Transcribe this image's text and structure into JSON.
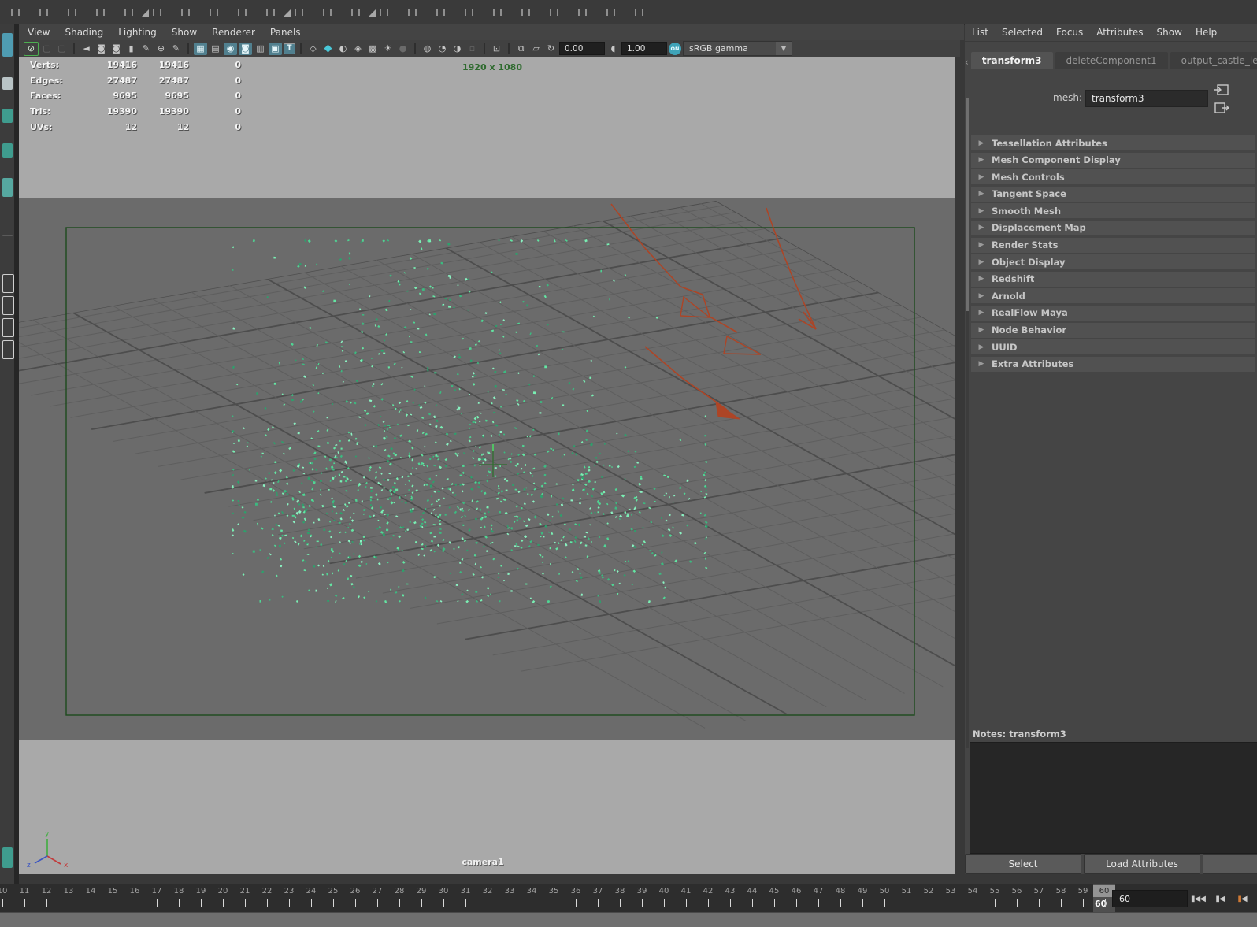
{
  "colors": {
    "accent_teal": "#49c8d8",
    "gate_green": "#1d4a1d",
    "resolution_green": "#2f6b2f",
    "arrow_red": "#ad4526",
    "particle_green": "#63e6a3",
    "selected_green": "#4caf50"
  },
  "viewport": {
    "menus": [
      "View",
      "Shading",
      "Lighting",
      "Show",
      "Renderer",
      "Panels"
    ],
    "toolbar": {
      "icons": [
        {
          "name": "no-live-surface-icon",
          "glyph": "⊘",
          "state": "green"
        },
        {
          "name": "lasso-select-icon",
          "glyph": "▢",
          "state": "dim"
        },
        {
          "name": "paint-select-icon",
          "glyph": "▢",
          "state": "dim"
        },
        {
          "name": "sep"
        },
        {
          "name": "select-camera-icon",
          "glyph": "◄",
          "state": ""
        },
        {
          "name": "lock-camera-icon",
          "glyph": "◙",
          "state": ""
        },
        {
          "name": "camera-attributes-icon",
          "glyph": "◙",
          "state": ""
        },
        {
          "name": "bookmark-icon",
          "glyph": "▮",
          "state": ""
        },
        {
          "name": "image-plane-icon",
          "glyph": "✎",
          "state": ""
        },
        {
          "name": "pan-zoom-icon",
          "glyph": "⊕",
          "state": ""
        },
        {
          "name": "grease-pencil-icon",
          "glyph": "✎",
          "state": ""
        },
        {
          "name": "sep"
        },
        {
          "name": "grid-toggle-icon",
          "glyph": "▦",
          "state": "on"
        },
        {
          "name": "film-gate-icon",
          "glyph": "▤",
          "state": ""
        },
        {
          "name": "resolution-gate-icon",
          "glyph": "◉",
          "state": "on"
        },
        {
          "name": "gate-mask-icon",
          "glyph": "◙",
          "state": "on"
        },
        {
          "name": "field-chart-icon",
          "glyph": "▥",
          "state": ""
        },
        {
          "name": "safe-action-icon",
          "glyph": "▣",
          "state": "on"
        },
        {
          "name": "safe-title-icon",
          "glyph": "T",
          "state": "on tbox"
        },
        {
          "name": "sep"
        },
        {
          "name": "wireframe-mode-icon",
          "glyph": "◇",
          "state": ""
        },
        {
          "name": "shaded-mode-icon",
          "glyph": "◆",
          "state": "teal"
        },
        {
          "name": "textured-mode-icon",
          "glyph": "◐",
          "state": ""
        },
        {
          "name": "materials-icon",
          "glyph": "◈",
          "state": ""
        },
        {
          "name": "wireframe-on-shaded-icon",
          "glyph": "▩",
          "state": ""
        },
        {
          "name": "lights-icon",
          "glyph": "☀",
          "state": ""
        },
        {
          "name": "shadows-icon",
          "glyph": "●",
          "state": "dim"
        },
        {
          "name": "sep"
        },
        {
          "name": "ao-icon",
          "glyph": "◍",
          "state": ""
        },
        {
          "name": "antialias-icon",
          "glyph": "◔",
          "state": ""
        },
        {
          "name": "motion-blur-icon",
          "glyph": "◑",
          "state": ""
        },
        {
          "name": "dof-icon",
          "glyph": "▫",
          "state": "dim"
        },
        {
          "name": "sep"
        },
        {
          "name": "isolate-select-icon",
          "glyph": "⊡",
          "state": ""
        },
        {
          "name": "sep"
        },
        {
          "name": "xray-icon",
          "glyph": "⧉",
          "state": ""
        },
        {
          "name": "xray-active-icon",
          "glyph": "▱",
          "state": ""
        },
        {
          "name": "exposure-icon",
          "glyph": "↻",
          "state": ""
        }
      ],
      "exposure": "0.00",
      "gamma_icon": "◖",
      "gamma": "1.00",
      "on_label": "ON",
      "colorspace": "sRGB gamma",
      "dropdown_arrow": "▼"
    },
    "hud": {
      "rows": [
        {
          "label": "Verts:",
          "a": "19416",
          "b": "19416",
          "c": "0"
        },
        {
          "label": "Edges:",
          "a": "27487",
          "b": "27487",
          "c": "0"
        },
        {
          "label": "Faces:",
          "a": "9695",
          "b": "9695",
          "c": "0"
        },
        {
          "label": "Tris:",
          "a": "19390",
          "b": "19390",
          "c": "0"
        },
        {
          "label": "UVs:",
          "a": "12",
          "b": "12",
          "c": "0"
        }
      ]
    },
    "resolution_label": "1920 x 1080",
    "camera_label": "camera1",
    "axis_labels": {
      "x": "x",
      "y": "y",
      "z": "z"
    }
  },
  "attribute_editor": {
    "menus": [
      "List",
      "Selected",
      "Focus",
      "Attributes",
      "Show",
      "Help"
    ],
    "tabs": [
      {
        "label": "transform3",
        "active": true
      },
      {
        "label": "deleteComponent1",
        "active": false
      },
      {
        "label": "output_castle_leaves_Al",
        "active": false
      }
    ],
    "tab_scroll_left": "‹",
    "mesh_label": "mesh:",
    "mesh_value": "transform3",
    "sections": [
      "Tessellation Attributes",
      "Mesh Component Display",
      "Mesh Controls",
      "Tangent Space",
      "Smooth Mesh",
      "Displacement Map",
      "Render Stats",
      "Object Display",
      "Redshift",
      "Arnold",
      "RealFlow Maya",
      "Node Behavior",
      "UUID",
      "Extra Attributes"
    ],
    "section_arrow": "▶",
    "notes_label": "Notes:",
    "notes_target": "transform3",
    "buttons": [
      "Select",
      "Load Attributes"
    ]
  },
  "timeline": {
    "start": 10,
    "end": 60,
    "current": 60,
    "current_display": "60",
    "field_value": "60",
    "buttons": [
      {
        "name": "go-to-start-button",
        "glyph": "▮◀◀"
      },
      {
        "name": "step-back-key-button",
        "glyph": "▮◀"
      },
      {
        "name": "step-back-frame-button",
        "glyph": "▮◀",
        "orange": true
      }
    ]
  }
}
